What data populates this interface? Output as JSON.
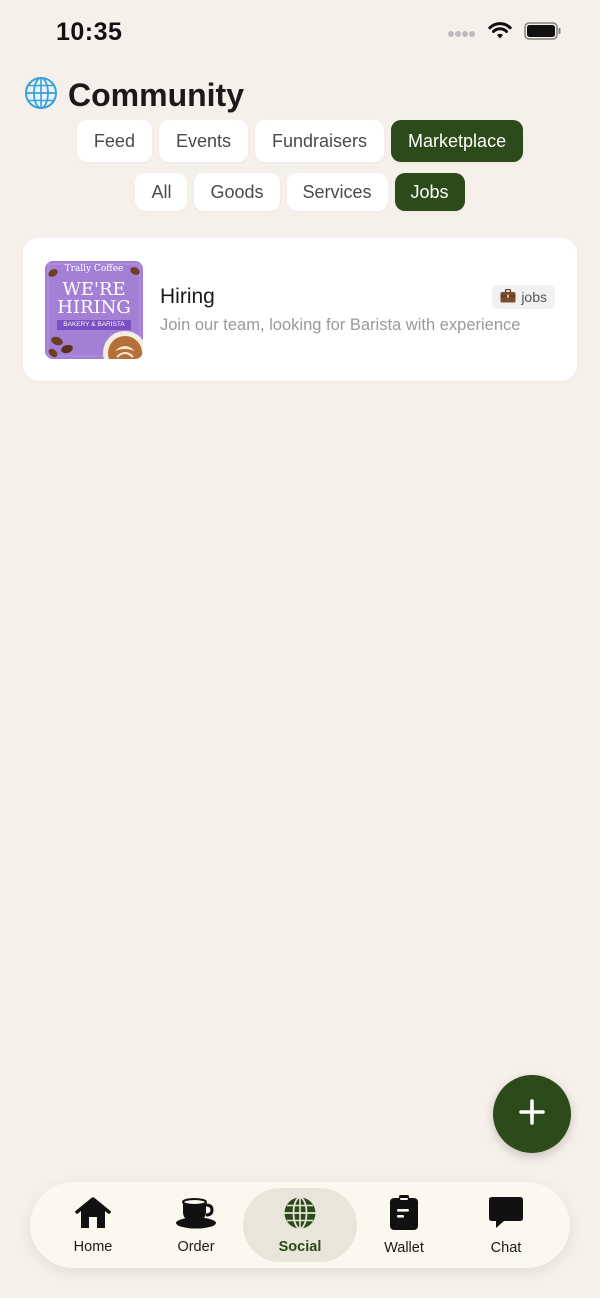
{
  "status_bar": {
    "time": "10:35"
  },
  "header": {
    "title": "Community",
    "icon": "globe-icon"
  },
  "primary_tabs": [
    {
      "label": "Feed",
      "active": false
    },
    {
      "label": "Events",
      "active": false
    },
    {
      "label": "Fundraisers",
      "active": false
    },
    {
      "label": "Marketplace",
      "active": true
    }
  ],
  "secondary_tabs": [
    {
      "label": "All",
      "active": false
    },
    {
      "label": "Goods",
      "active": false
    },
    {
      "label": "Services",
      "active": false
    },
    {
      "label": "Jobs",
      "active": true
    }
  ],
  "listings": [
    {
      "title": "Hiring",
      "description": "Join our team, looking for Barista with experience",
      "tag": "jobs",
      "tag_icon": "briefcase-icon",
      "thumbnail": {
        "brand": "Trally Coffee",
        "headline_1": "WE'RE",
        "headline_2": "HIRING",
        "subline": "BAKERY & BARISTA"
      }
    }
  ],
  "fab": {
    "icon": "plus-icon"
  },
  "bottom_nav": [
    {
      "label": "Home",
      "icon": "home-icon",
      "active": false
    },
    {
      "label": "Order",
      "icon": "coffee-cup-icon",
      "active": false
    },
    {
      "label": "Social",
      "icon": "globe-icon",
      "active": true
    },
    {
      "label": "Wallet",
      "icon": "wallet-icon",
      "active": false
    },
    {
      "label": "Chat",
      "icon": "chat-bubble-icon",
      "active": false
    }
  ],
  "colors": {
    "background": "#f5f0e9",
    "accent": "#2d4a1b",
    "card": "#ffffff",
    "thumbnail_purple": "#a37fd6"
  }
}
